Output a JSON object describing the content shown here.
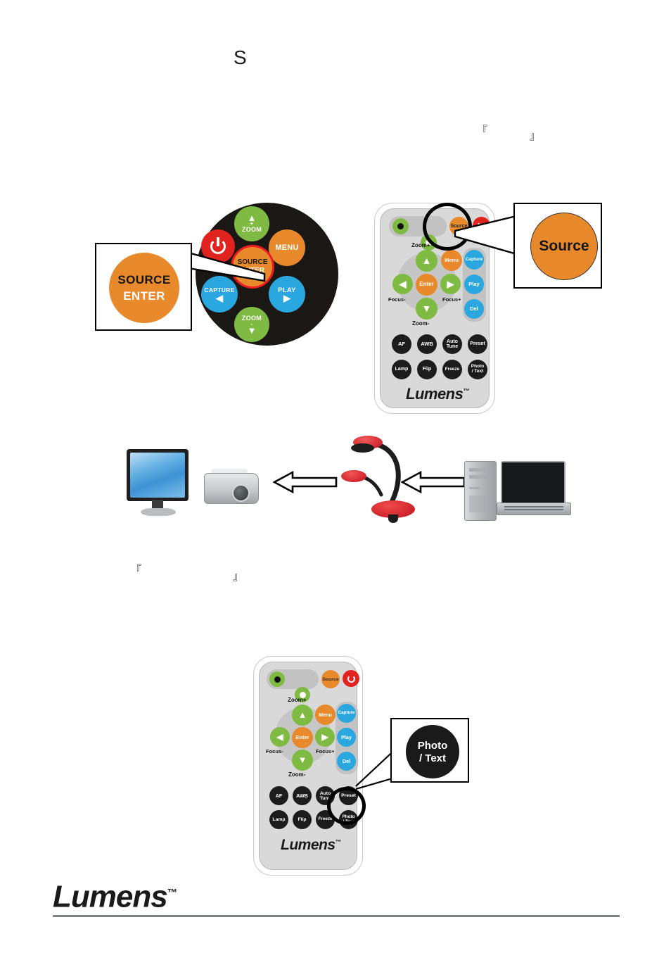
{
  "document": {
    "stray_text": "S",
    "bracket_open": "『",
    "bracket_close": "』"
  },
  "control_panel": {
    "name": "control-panel",
    "disc_color": "#1b1715",
    "buttons": [
      {
        "id": "zoom-in",
        "label": "ZOOM",
        "sub": "+",
        "arrow": "▲",
        "color": "#7fbb42"
      },
      {
        "id": "power",
        "label": "",
        "color": "#e0231f",
        "icon": "power-icon"
      },
      {
        "id": "menu",
        "label": "MENU",
        "color": "#e88a2c"
      },
      {
        "id": "source-enter",
        "label_top": "SOURCE",
        "label_bottom": "ENTER",
        "color": "#e88a2c",
        "ring": "#ee1c22"
      },
      {
        "id": "capture",
        "label": "CAPTURE",
        "arrow": "◀",
        "color": "#2ba7e0"
      },
      {
        "id": "play",
        "label": "PLAY",
        "arrow": "▶",
        "color": "#2ba7e0"
      },
      {
        "id": "zoom-out",
        "label": "ZOOM",
        "sub": "-",
        "arrow": "▼",
        "color": "#7fbb42"
      }
    ]
  },
  "callout_source_enter": {
    "line1": "SOURCE",
    "line2": "ENTER",
    "circle_color": "#e88a2c"
  },
  "callout_source": {
    "label": "Source",
    "circle_color": "#e88a2c"
  },
  "callout_photo_text": {
    "line1": "Photo",
    "line2": "/ Text",
    "circle_color": "#1a1a1a"
  },
  "remote": {
    "brand": "Lumens",
    "trademark": "™",
    "top_row": [
      {
        "id": "brightness-down",
        "label": "",
        "color": "#7fbb42",
        "icon": "sun-dark-icon"
      },
      {
        "id": "brightness-up",
        "label": "",
        "color": "#7fbb42",
        "icon": "sun-light-icon"
      },
      {
        "id": "source",
        "label": "Source",
        "color": "#e88a2c"
      },
      {
        "id": "power",
        "label": "",
        "color": "#e0231f",
        "icon": "power-icon"
      }
    ],
    "dpad": {
      "up": {
        "label": "▲",
        "caption": "Zoom+",
        "color": "#7fbb42"
      },
      "down": {
        "label": "▼",
        "caption": "Zoom-",
        "color": "#7fbb42"
      },
      "left": {
        "label": "◀",
        "caption": "Focus-",
        "color": "#7fbb42"
      },
      "right": {
        "label": "▶",
        "caption": "Focus+",
        "color": "#7fbb42"
      },
      "center": {
        "label": "Enter",
        "color": "#e88a2c"
      }
    },
    "menu": {
      "label": "Menu",
      "color": "#e88a2c"
    },
    "side_column": [
      {
        "id": "capture",
        "label": "Capture",
        "color": "#2ba7e0"
      },
      {
        "id": "play",
        "label": "Play",
        "color": "#2ba7e0"
      },
      {
        "id": "del",
        "label": "Del",
        "color": "#2ba7e0"
      }
    ],
    "grid_row1": [
      {
        "id": "af",
        "label": "AF"
      },
      {
        "id": "awb",
        "label": "AWB"
      },
      {
        "id": "auto-tune",
        "line1": "Auto",
        "line2": "Tune"
      },
      {
        "id": "preset",
        "label": "Preset"
      }
    ],
    "grid_row2": [
      {
        "id": "lamp",
        "label": "Lamp"
      },
      {
        "id": "flip",
        "label": "Flip"
      },
      {
        "id": "freeze",
        "label": "Freeze"
      },
      {
        "id": "photo-text",
        "line1": "Photo",
        "line2": "/ Text"
      }
    ]
  },
  "device_diagram": {
    "nodes": [
      "monitor",
      "projector",
      "document-camera",
      "pc-tower",
      "laptop"
    ],
    "arrow_direction": "left"
  },
  "footer": {
    "brand": "Lumens",
    "trademark": "™"
  }
}
